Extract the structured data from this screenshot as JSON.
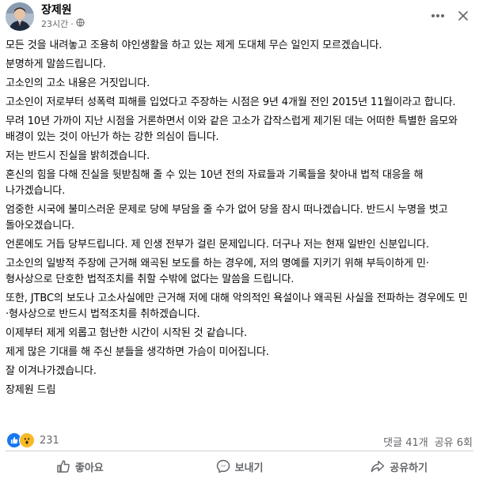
{
  "post": {
    "author": "장제원",
    "time": "23시간",
    "paragraphs": [
      "모든 것을 내려놓고 조용히 야인생활을 하고 있는 제게 도대체 무슨 일인지 모르겠습니다.",
      "분명하게 말씀드립니다.",
      "고소인의 고소 내용은 거짓입니다.",
      "고소인이 저로부터 성폭력 피해를 입었다고 주장하는 시점은 9년 4개월 전인 2015년 11월이라고 합니다.",
      "무려 10년 가까이 지난 시점을 거론하면서 이와 같은 고소가 갑작스럽게 제기된 데는 어떠한 특별한 음모와 배경이 있는 것이 아닌가 하는 강한 의심이 듭니다.",
      "저는 반드시 진실을 밝히겠습니다.",
      "혼신의 힘을 다해 진실을 뒷받침해 줄 수 있는 10년 전의 자료들과 기록들을 찾아내 법적 대응을 해 나가겠습니다.",
      "엄중한 시국에 불미스러운 문제로 당에 부담을 줄 수가 없어 당을 잠시 떠나겠습니다. 반드시 누명을 벗고 돌아오겠습니다.",
      "언론에도 거듭 당부드립니다. 제 인생 전부가 걸린 문제입니다. 더구나 저는 현재 일반인 신분입니다.",
      "고소인의 일방적 주장에 근거해 왜곡된 보도를 하는 경우에, 저의 명예를 지키기 위해 부득이하게 민·형사상으로 단호한 법적조치를 취할 수밖에 없다는 말씀을 드립니다.",
      "또한, JTBC의 보도나 고소사실에만 근거해 저에 대해 악의적인 욕설이나 왜곡된 사실을 전파하는 경우에도 민·형사상으로 반드시 법적조치를 취하겠습니다.",
      "이제부터 제게 외롭고 험난한 시간이 시작된 것 같습니다.",
      "제게 많은 기대를 해 주신 분들을 생각하면 가슴이 미어집니다.",
      "잘 이겨나가겠습니다.",
      "장제원 드림"
    ]
  },
  "stats": {
    "reaction_count": "231",
    "comments": "댓글 41개",
    "shares": "공유 6회"
  },
  "actions": {
    "like": "좋아요",
    "send": "보내기",
    "share": "공유하기"
  },
  "colors": {
    "like_blue": "#1877f2",
    "wow_yellow": "#f7b928",
    "muted": "#65676b"
  }
}
